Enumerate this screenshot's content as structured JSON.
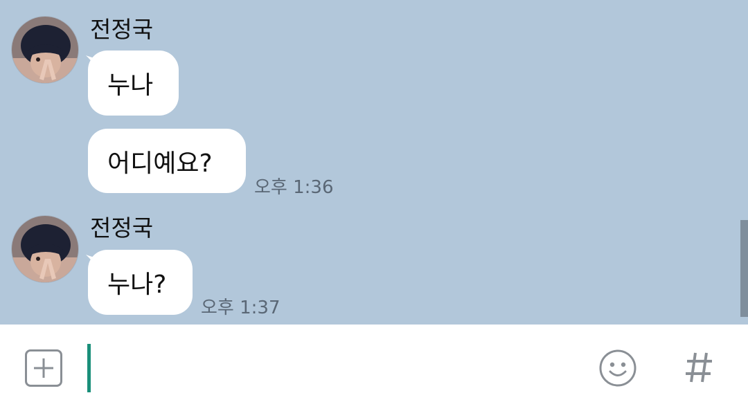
{
  "messages": [
    {
      "sender": "전정국",
      "bubbles": [
        {
          "text": "누나"
        },
        {
          "text": "어디예요?",
          "time": "오후 1:36"
        }
      ]
    },
    {
      "sender": "전정국",
      "bubbles": [
        {
          "text": "누나?",
          "time": "오후 1:37"
        }
      ]
    }
  ],
  "input": {
    "value": "",
    "placeholder": ""
  },
  "icons": {
    "attach": "plus-square-icon",
    "emoticon": "smiley-icon",
    "hashtag": "hash-icon"
  },
  "colors": {
    "chat_background": "#b2c7da",
    "bubble": "#ffffff",
    "cursor": "#1a8f7a",
    "icon": "#8a8f95"
  }
}
